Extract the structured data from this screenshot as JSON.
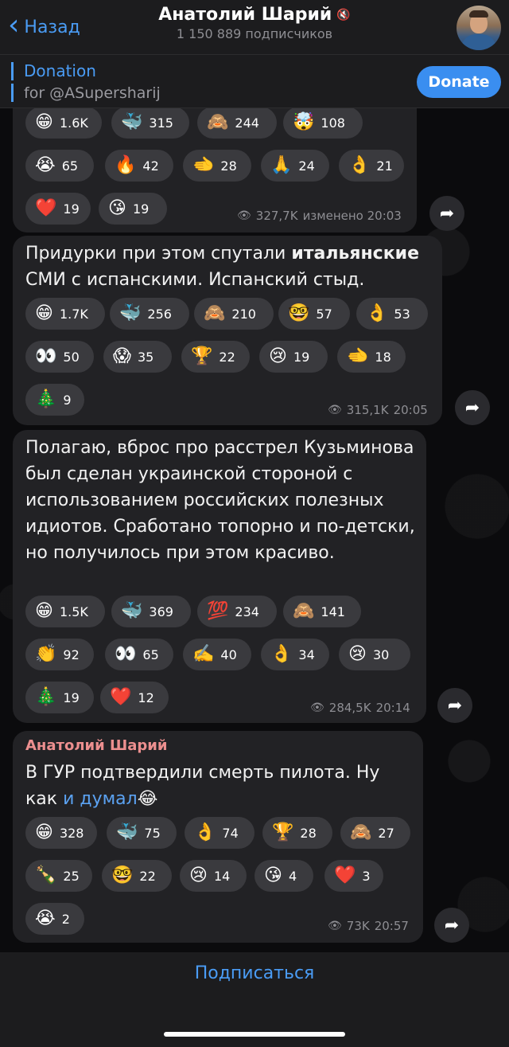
{
  "header": {
    "back_label": "Назад",
    "channel_name": "Анатолий Шарий",
    "mute_icon": "🔇",
    "subscribers": "1 150 889 подписчиков"
  },
  "pinned": {
    "title": "Donation",
    "subtitle": "for @ASupersharij",
    "button": "Donate"
  },
  "posts": [
    {
      "reactions": [
        {
          "emoji": "😁",
          "count": "1.6K"
        },
        {
          "emoji": "🐳",
          "count": "315"
        },
        {
          "emoji": "🙈",
          "count": "244"
        },
        {
          "emoji": "🤯",
          "count": "108"
        },
        {
          "emoji": "😭",
          "count": "65"
        },
        {
          "emoji": "🔥",
          "count": "42"
        },
        {
          "emoji": "🫲",
          "count": "28"
        },
        {
          "emoji": "🙏",
          "count": "24"
        },
        {
          "emoji": "👌",
          "count": "21"
        },
        {
          "emoji": "❤️",
          "count": "19"
        },
        {
          "emoji": "😘",
          "count": "19"
        }
      ],
      "views": "327,7K",
      "time": "изменено 20:03"
    },
    {
      "text_before": "Придурки при этом спутали ",
      "text_bold": "итальянские",
      "text_after": " СМИ с испанскими. Испанский стыд.",
      "reactions": [
        {
          "emoji": "😁",
          "count": "1.7K"
        },
        {
          "emoji": "🐳",
          "count": "256"
        },
        {
          "emoji": "🙈",
          "count": "210"
        },
        {
          "emoji": "🤓",
          "count": "57"
        },
        {
          "emoji": "👌",
          "count": "53"
        },
        {
          "emoji": "👀",
          "count": "50"
        },
        {
          "emoji": "😱",
          "count": "35"
        },
        {
          "emoji": "🏆",
          "count": "22"
        },
        {
          "emoji": "😢",
          "count": "19"
        },
        {
          "emoji": "🫲",
          "count": "18"
        },
        {
          "emoji": "🎄",
          "count": "9"
        }
      ],
      "views": "315,1K",
      "time": "20:05"
    },
    {
      "text": "Полагаю, вброс про расстрел Кузьминова был сделан украинской стороной с использованием российских полезных идиотов. Сработано топорно и по-детски, но получилось при этом красиво.",
      "reactions": [
        {
          "emoji": "😁",
          "count": "1.5K"
        },
        {
          "emoji": "🐳",
          "count": "369"
        },
        {
          "emoji": "💯",
          "count": "234"
        },
        {
          "emoji": "🙈",
          "count": "141"
        },
        {
          "emoji": "👏",
          "count": "92"
        },
        {
          "emoji": "👀",
          "count": "65"
        },
        {
          "emoji": "✍️",
          "count": "40"
        },
        {
          "emoji": "👌",
          "count": "34"
        },
        {
          "emoji": "😢",
          "count": "30"
        },
        {
          "emoji": "🎄",
          "count": "19"
        },
        {
          "emoji": "❤️",
          "count": "12"
        }
      ],
      "views": "284,5K",
      "time": "20:14"
    },
    {
      "author": "Анатолий Шарий",
      "text_before": "В ГУР подтвердили смерть пилота. Ну как ",
      "text_link": "и думал",
      "text_emoji": "😂",
      "reactions": [
        {
          "emoji": "😁",
          "count": "328"
        },
        {
          "emoji": "🐳",
          "count": "75"
        },
        {
          "emoji": "👌",
          "count": "74"
        },
        {
          "emoji": "🏆",
          "count": "28"
        },
        {
          "emoji": "🙈",
          "count": "27"
        },
        {
          "emoji": "🍾",
          "count": "25"
        },
        {
          "emoji": "🤓",
          "count": "22"
        },
        {
          "emoji": "😢",
          "count": "14"
        },
        {
          "emoji": "😘",
          "count": "4"
        },
        {
          "emoji": "❤️",
          "count": "3"
        },
        {
          "emoji": "😭",
          "count": "2"
        }
      ],
      "views": "73K",
      "time": "20:57"
    }
  ],
  "bottom": {
    "subscribe_label": "Подписаться"
  },
  "colors": {
    "accent": "#4a9cf5",
    "author": "#ec8f8f",
    "bubble": "#222225",
    "reaction": "#3a3a3e"
  }
}
